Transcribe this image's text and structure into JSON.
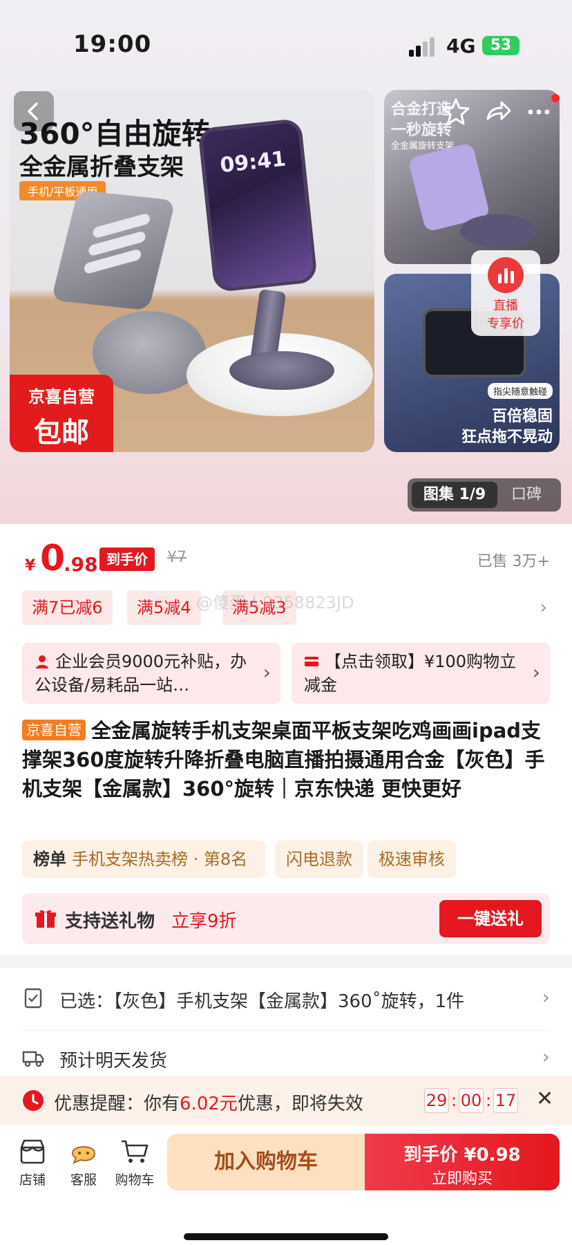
{
  "status": {
    "time": "19:00",
    "network": "4G",
    "battery": "53"
  },
  "hero": {
    "main_title": "360°自由旋转",
    "main_subtitle": "全金属折叠支架",
    "main_tag": "手机/平板通用",
    "phone_clock": "09:41",
    "promo_line1": "京喜自营",
    "promo_line2": "包邮",
    "side_top_line1": "合金打造",
    "side_top_line2": "一秒旋转",
    "side_top_line3": "全金属旋转支架",
    "side_bottom_tag": "指尖随意触碰",
    "side_bottom_line1": "百倍稳固",
    "side_bottom_line2": "狂点拖不晃动",
    "live_line1": "直播",
    "live_line2": "专享价",
    "gallery_label": "图集 1/9",
    "reviews_label": "口碑"
  },
  "price": {
    "currency": "¥",
    "integer": "0",
    "decimal": ".98",
    "badge": "到手价",
    "original": "¥7",
    "sold": "已售 3万+"
  },
  "coupons": [
    "满7已减6",
    "满5减4",
    "满5减3"
  ],
  "watermark": "@傻蛋人9358823JD",
  "benefits": [
    {
      "text": "企业会员9000元补贴，办公设备/易耗品一站…"
    },
    {
      "text": "【点击领取】¥100购物立减金"
    }
  ],
  "product": {
    "self_tag": "京喜自营",
    "title": "全金属旋转手机支架桌面平板支架吃鸡画画ipad支撑架360度旋转升降折叠电脑直播拍摄通用合金【灰色】手机支架【金属款】360°旋转｜京东快递 更快更好"
  },
  "chips": {
    "rank_label": "榜单",
    "rank_text": "手机支架热卖榜 · 第8名",
    "chip2": "闪电退款",
    "chip3": "极速审核"
  },
  "gift": {
    "label": "支持送礼物",
    "discount": "立享9折",
    "button": "一键送礼"
  },
  "selection": {
    "selected": "已选：【灰色】手机支架【金属款】360˚旋转，1件",
    "shipping": "预计明天发货"
  },
  "reminder": {
    "prefix": "优惠提醒：你有",
    "amount": "6.02元",
    "suffix": "优惠，即将失效",
    "hh": "29",
    "mm": "00",
    "ss": "17"
  },
  "bottom": {
    "shop": "店铺",
    "service": "客服",
    "cart": "购物车",
    "add_cart": "加入购物车",
    "buy_price": "到手价 ¥0.98",
    "buy_now": "立即购买"
  },
  "colors": {
    "brand_red": "#e4181e",
    "orange": "#f57c21",
    "gold_text": "#a86a2a"
  }
}
